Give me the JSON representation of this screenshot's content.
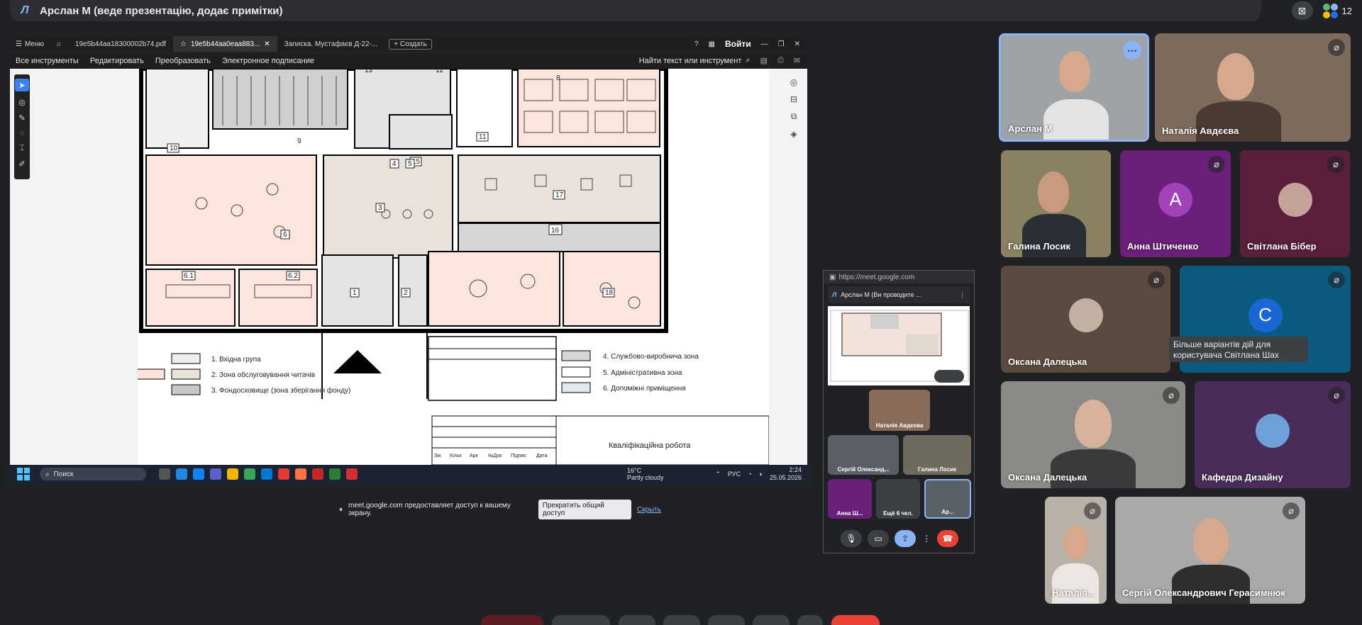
{
  "meet": {
    "title": "Арслан М (веде презентацію, додає примітки)",
    "participant_count": "12",
    "tooltip": "Більше варіантів дій для користувача Світлана Шах",
    "participants": [
      "Арслан М",
      "Наталія Авдєєва",
      "Галина Лосик",
      "Анна Штиченко",
      "Світлана Бібер",
      "Оксана Далецька",
      "Оксана Далецька",
      "Кафедра Дизайну",
      "Наталія...",
      "Сергій Олександрович Герасимнюк"
    ],
    "avatars": {
      "anna": "A",
      "c_user": "C"
    }
  },
  "acrobat": {
    "menu": "Меню",
    "tabs": [
      "19e5b44aa18300002b74.pdf",
      "19e5b44aa0eaa883...",
      "Записка. Мустафаєв Д-22-..."
    ],
    "new_tab": "Создать",
    "sign_in": "Войти",
    "tools": [
      "Все инструменты",
      "Редактировать",
      "Преобразовать",
      "Электронное подписание"
    ],
    "find": "Найти текст или инструмент"
  },
  "drawing": {
    "legend": [
      "1. Вхідна група",
      "2. Зона обслуговування читачів",
      "3. Фондосховище (зона зберігання фонду)",
      "4. Службово-виробнича зона",
      "5. Адміністративна зона",
      "6. Допоміжні приміщення"
    ],
    "stamp": "Кваліфікаційна робота",
    "stamp_cols": [
      "Зм",
      "Кільк",
      "Арк",
      "№Док",
      "Підпис",
      "Дата"
    ],
    "room_numbers": [
      "10",
      "9",
      "13",
      "12",
      "11",
      "15",
      "8",
      "4",
      "5",
      "3",
      "17",
      "16",
      "6",
      "6.1",
      "6.2",
      "1",
      "2",
      "18"
    ]
  },
  "sharebar": {
    "text": "meet.google.com предоставляет доступ к вашему экрану.",
    "stop": "Прекратить общий доступ",
    "hide": "Скрыть"
  },
  "taskbar": {
    "search": "Поиск",
    "temp": "16°C",
    "weather": "Partly cloudy",
    "lang": "РУС",
    "time": "2:24",
    "date": "25.05.2026"
  },
  "pip": {
    "url": "https://meet.google.com",
    "header": "Арслан М (Ви проводите ...",
    "tiles": [
      "Наталія Авдєєва",
      "Сергій Олександ...",
      "Галина Лосик",
      "Анна Ш...",
      "Ещё 6 чел.",
      "Ар..."
    ]
  },
  "colors": {
    "accent": "#8ab4f8",
    "end_call": "#ea4335",
    "anna_tile": "#6a1f79",
    "svitlana_tile": "#5a1f3a",
    "c_tile": "#0b5a80"
  }
}
